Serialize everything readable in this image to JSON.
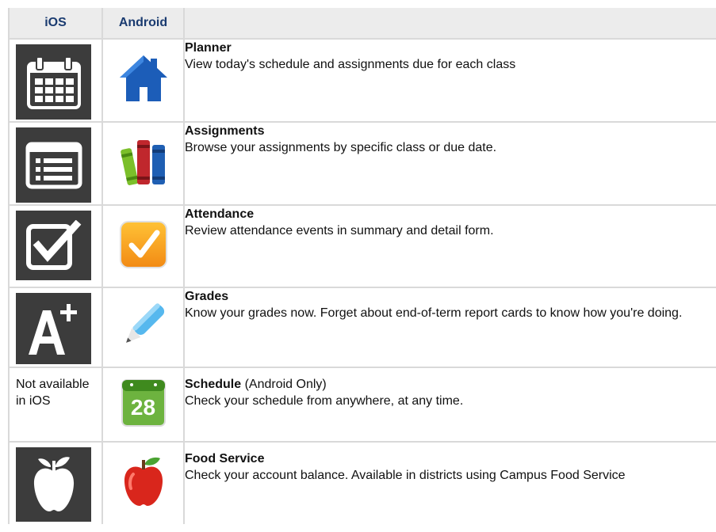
{
  "header": {
    "ios": "iOS",
    "android": "Android",
    "description": ""
  },
  "rows": [
    {
      "title": "Planner",
      "suffix": "",
      "desc": "View today's schedule and assignments due for each class",
      "ios_icon": "calendar-icon",
      "android_icon": "house-icon"
    },
    {
      "title": "Assignments",
      "suffix": "",
      "desc": "Browse your assignments by specific class or due date.",
      "ios_icon": "list-icon",
      "android_icon": "books-icon"
    },
    {
      "title": "Attendance",
      "suffix": "",
      "desc": "Review attendance events in summary and detail form.",
      "ios_icon": "checkbox-icon",
      "android_icon": "check-icon"
    },
    {
      "title": "Grades",
      "suffix": "",
      "desc": "Know your grades now. Forget about end-of-term report cards to know how you're doing.",
      "ios_icon": "a-plus-icon",
      "android_icon": "pen-icon"
    },
    {
      "title": "Schedule",
      "suffix": " (Android Only)",
      "desc": "Check your schedule from anywhere, at any time.",
      "ios_text": "Not available in iOS",
      "android_icon": "calendar-28-icon",
      "android_icon_text": "28"
    },
    {
      "title": "Food Service",
      "suffix": "",
      "desc": "Check your account balance. Available in districts using Campus Food Service",
      "ios_icon": "apple-icon",
      "android_icon": "apple-icon"
    }
  ],
  "colors": {
    "header_text": "#1a3b70",
    "header_bg": "#ececec",
    "ios_tile": "#3c3c3c",
    "border": "#d9d9d9"
  }
}
